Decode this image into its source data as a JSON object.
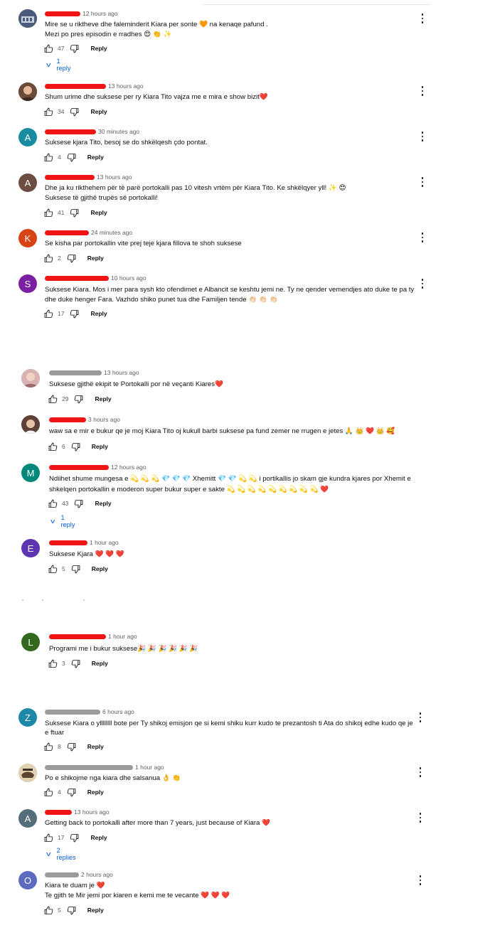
{
  "comments": [
    {
      "avatar_letter": "",
      "avatar_color": "#5f6f8a",
      "time": "12 hours ago",
      "lines": [
        "Mire se u riktheve dhe faleminderit Kiara per sonte 🧡 na kenaqe pafund .",
        "Mezi po pres episodin e rradhes 😍 👏 ✨"
      ],
      "likes": "47",
      "reply": "Reply",
      "replies_link": "1 reply"
    },
    {
      "avatar_letter": "",
      "avatar_color": "#7a5a48",
      "time": "13 hours ago",
      "lines": [
        "Shum urime dhe suksese per ry Kiara Tito vajza me e mira e show bizit❤️"
      ],
      "likes": "34",
      "reply": "Reply"
    },
    {
      "avatar_letter": "A",
      "avatar_color": "#1a8ca1",
      "time": "30 minutes ago",
      "lines": [
        "Suksese kjara Tito, besoj se do shkëlqesh çdo pontat."
      ],
      "likes": "4",
      "reply": "Reply"
    },
    {
      "avatar_letter": "A",
      "avatar_color": "#6d4c41",
      "time": "13 hours ago",
      "lines": [
        "Dhe ja ku rikthehem për të parë portokalli pas 10 vitesh vrtëm për Kiara Tito. Ke shkëlqyer yll! ✨ 😍",
        "Suksese të gjithë trupës së portokalli!"
      ],
      "likes": "41",
      "reply": "Reply"
    },
    {
      "avatar_letter": "K",
      "avatar_color": "#d84315",
      "time": "24 minutes ago",
      "lines": [
        "Se kisha par portokallin vite prej teje kjara fillova te shoh suksese"
      ],
      "likes": "2",
      "reply": "Reply"
    },
    {
      "avatar_letter": "S",
      "avatar_color": "#7b1fa2",
      "time": "10 hours ago",
      "lines": [
        "Suksese Kiara. Mos i mer para sysh kto ofendimet e Albancit se keshtu jemi ne. Ty ne qender vemendjes ato duke te pa ty",
        "dhe duke henger Fara. Vazhdo shiko punet tua dhe Familjen tende 👏🏻 👏🏻 👏🏻"
      ],
      "likes": "17",
      "reply": "Reply"
    },
    {
      "avatar_letter": "",
      "avatar_color": "#c98f8f",
      "time": "13 hours ago",
      "lines": [
        "Suksese gjithë ekipit te Portokalli por në veçanti Kiares❤️"
      ],
      "likes": "29",
      "reply": "Reply"
    },
    {
      "avatar_letter": "",
      "avatar_color": "#8d6e63",
      "time": "3 hours ago",
      "lines": [
        "waw sa e mir e bukur qe je moj  Kiara Tito oj kukull barbi suksese pa fund zemer ne rrugen e jetes 🙏 👑 ❤️ 👑 🥰"
      ],
      "likes": "6",
      "reply": "Reply"
    },
    {
      "avatar_letter": "M",
      "avatar_color": "#00897b",
      "time": "12 hours ago",
      "lines": [
        "Ndiihet shume mungesa e 💫 💫 💫 💎 💎 💎 Xhemitt 💎 💎 💫 💫 i portikallis jo skam gje kundra kjares por Xhemit e",
        "shkelqen portokallin e moderon super bukur super e sakte 💫 💫 💫 💫 💫 💫 💫 💫 💫 ❤️"
      ],
      "likes": "43",
      "reply": "Reply",
      "replies_link": "1 reply"
    },
    {
      "avatar_letter": "E",
      "avatar_color": "#5e35b1",
      "time": "1 hour ago",
      "lines": [
        "Suksese Kjara ❤️ ❤️ ❤️"
      ],
      "likes": "5",
      "reply": "Reply"
    },
    {
      "avatar_letter": "L",
      "avatar_color": "#33691e",
      "time": "1 hour ago",
      "lines": [
        "Programi me i bukur suksese🎉 🎉 🎉 🎉 🎉 🎉"
      ],
      "likes": "3",
      "reply": "Reply"
    },
    {
      "avatar_letter": "Z",
      "avatar_color": "#1e88a8",
      "time": "6 hours ago",
      "lines": [
        "Suksese Kiara o yllllllll bote per Ty shikoj emisjon qe si kemi shiku kurr kudo te prezantosh ti Ata do shikoj edhe kudo qe je",
        "e ftuar"
      ],
      "likes": "8",
      "reply": "Reply"
    },
    {
      "avatar_letter": "",
      "avatar_color": "#a1887f",
      "time": "1 hour ago",
      "lines": [
        "Po e shikojme nga kiara dhe salsanua 👌 👏"
      ],
      "likes": "4",
      "reply": "Reply"
    },
    {
      "avatar_letter": "A",
      "avatar_color": "#546e7a",
      "time": "13 hours ago",
      "lines": [
        "Getting back to portokalli after more than 7 years, just because of Kiara ❤️"
      ],
      "likes": "17",
      "reply": "Reply",
      "replies_link": "2 replies"
    },
    {
      "avatar_letter": "O",
      "avatar_color": "#5c6bc0",
      "time": "2 hours ago",
      "lines": [
        "Kiara te duam je ❤️",
        "Te gjith te Mir jemi por kiaren e kemi me te vecante ❤️ ❤️ ❤️"
      ],
      "likes": "5",
      "reply": "Reply"
    }
  ]
}
